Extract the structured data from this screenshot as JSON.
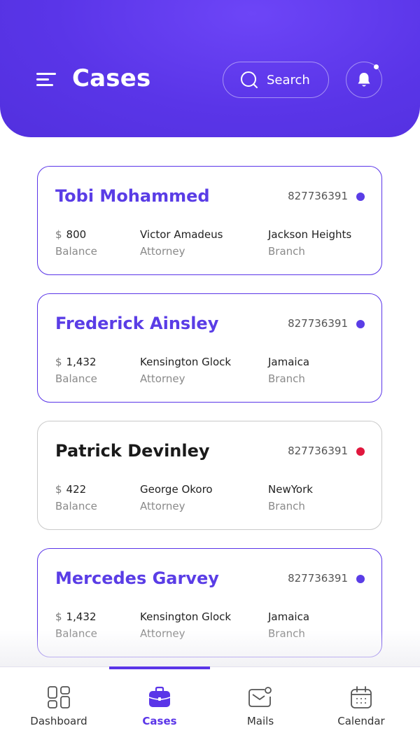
{
  "header": {
    "title": "Cases",
    "search_label": "Search",
    "menu_icon": "menu-icon",
    "search_icon": "search-icon",
    "bell_icon": "bell-icon"
  },
  "colors": {
    "primary": "#5a35e8",
    "status_active": "#5a3de6",
    "status_alert": "#e0173d"
  },
  "cases": [
    {
      "name": "Tobi Mohammed",
      "id": "827736391",
      "status": "active",
      "currency": "$",
      "balance": "800",
      "balance_label": "Balance",
      "attorney": "Victor Amadeus",
      "attorney_label": "Attorney",
      "branch": "Jackson Heights",
      "branch_label": "Branch"
    },
    {
      "name": "Frederick Ainsley",
      "id": "827736391",
      "status": "active",
      "currency": "$",
      "balance": "1,432",
      "balance_label": "Balance",
      "attorney": "Kensington Glock",
      "attorney_label": "Attorney",
      "branch": "Jamaica",
      "branch_label": "Branch"
    },
    {
      "name": "Patrick Devinley",
      "id": "827736391",
      "status": "alert",
      "currency": "$",
      "balance": "422",
      "balance_label": "Balance",
      "attorney": "George Okoro",
      "attorney_label": "Attorney",
      "branch": "NewYork",
      "branch_label": "Branch"
    },
    {
      "name": "Mercedes Garvey",
      "id": "827736391",
      "status": "active",
      "currency": "$",
      "balance": "1,432",
      "balance_label": "Balance",
      "attorney": "Kensington Glock",
      "attorney_label": "Attorney",
      "branch": "Jamaica",
      "branch_label": "Branch"
    }
  ],
  "tabs": [
    {
      "label": "Dashboard",
      "icon": "dashboard-icon",
      "active": false
    },
    {
      "label": "Cases",
      "icon": "briefcase-icon",
      "active": true
    },
    {
      "label": "Mails",
      "icon": "mail-icon",
      "active": false
    },
    {
      "label": "Calendar",
      "icon": "calendar-icon",
      "active": false
    }
  ]
}
